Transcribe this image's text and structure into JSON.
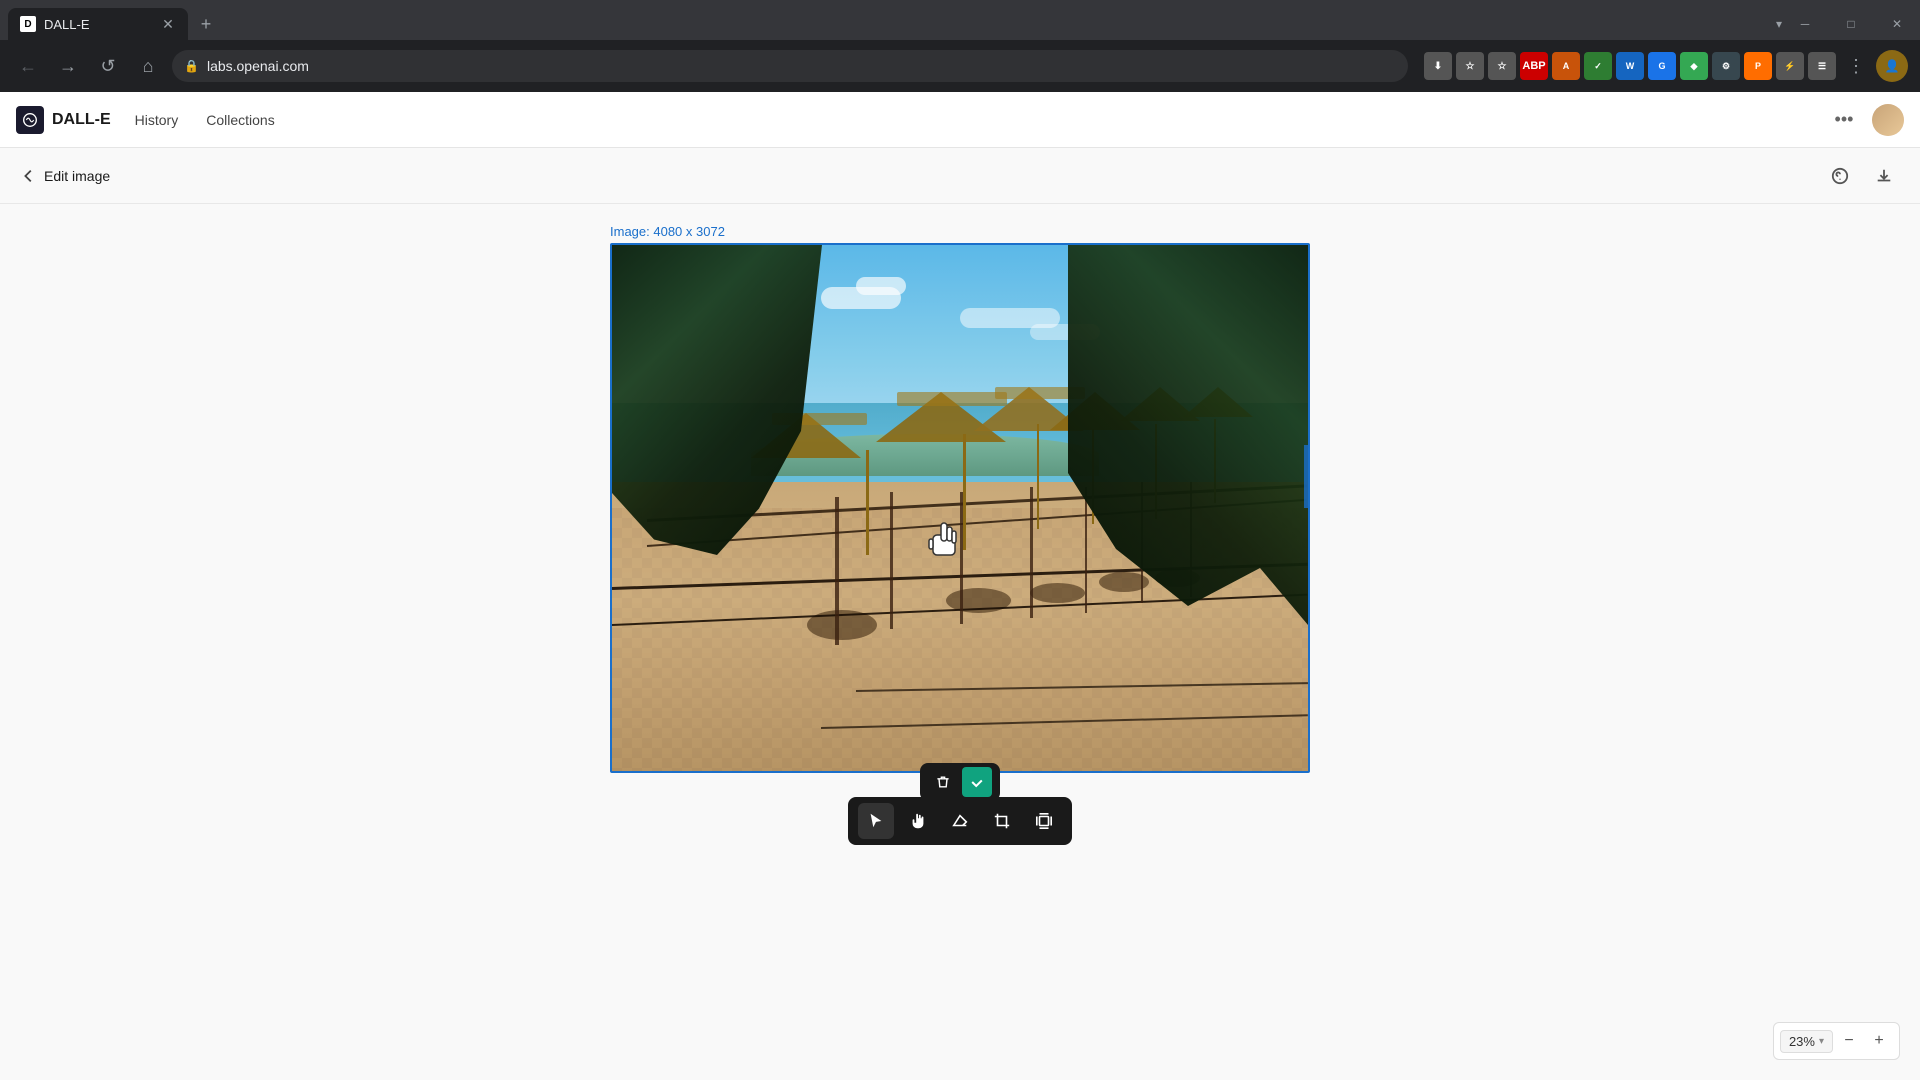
{
  "browser": {
    "tab_title": "DALL-E",
    "url": "labs.openai.com",
    "url_display": "labs.openai.com"
  },
  "app": {
    "name": "DALL-E",
    "logo_alt": "DALL-E logo",
    "nav": {
      "history": "History",
      "collections": "Collections"
    },
    "more_label": "•••",
    "edit_image_label": "Edit image",
    "image_dimensions": "Image: 4080 x 3072",
    "zoom_level": "23%"
  },
  "toolbar": {
    "help_label": "?",
    "download_label": "⬇"
  },
  "tools": {
    "select_label": "Select",
    "hand_label": "Hand",
    "eraser_label": "Eraser",
    "crop_label": "Crop",
    "outpaint_label": "Outpaint"
  },
  "selection_actions": {
    "delete_label": "Delete",
    "confirm_label": "Confirm"
  },
  "zoom": {
    "display": "23%",
    "decrease": "−",
    "increase": "+"
  }
}
